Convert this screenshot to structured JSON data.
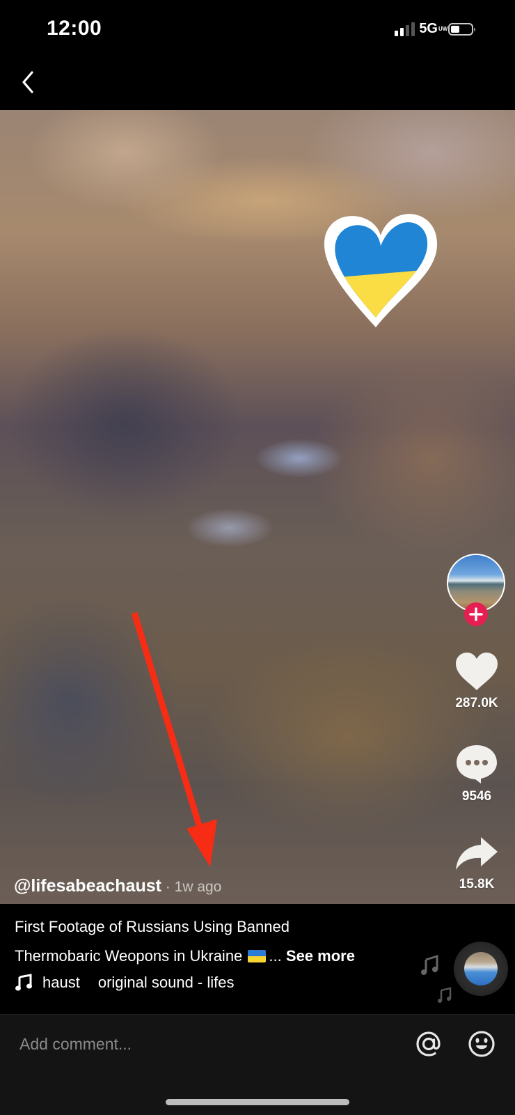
{
  "status_bar": {
    "time": "12:00",
    "network": "5G",
    "network_badge": "UW",
    "signal_bars_active": 2,
    "signal_bars_total": 4,
    "battery_level_fraction": 0.35
  },
  "nav": {
    "back_icon": "chevron-left-icon"
  },
  "video": {
    "sticker": "ukraine-flag-heart",
    "annotation": "red-arrow pointing to timestamp",
    "colors": {
      "flag_blue": "#1a86d9",
      "flag_yellow": "#fcdc3c",
      "arrow_red": "#ff2a12"
    }
  },
  "side_actions": {
    "follow_icon": "plus-icon",
    "follow_color": "#ee1d52",
    "likes": "287.0K",
    "comments": "9546",
    "shares": "15.8K"
  },
  "post": {
    "username": "@lifesabeachaust",
    "separator": " · ",
    "time_ago": "1w ago",
    "caption_line1": "First Footage of Russians Using Banned",
    "caption_line2": "Thermobaric Weopons in Ukraine",
    "caption_ellipsis": "...",
    "see_more": "See more",
    "sound_part1": "haust",
    "sound_part2": "original sound - lifes"
  },
  "comment_bar": {
    "placeholder": "Add comment...",
    "mention_icon": "at-icon",
    "emoji_icon": "smiley-icon"
  }
}
